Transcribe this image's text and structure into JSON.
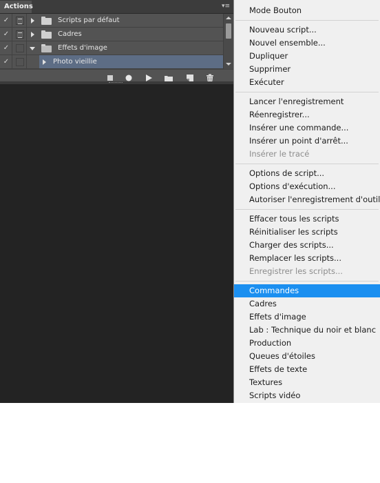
{
  "panel": {
    "tab_label": "Actions",
    "menu_glyph": "▾≡",
    "rows": [
      {
        "label": "Scripts par défaut",
        "checked": true,
        "dialog": true,
        "expanded": false,
        "type": "folder"
      },
      {
        "label": "Cadres",
        "checked": true,
        "dialog": true,
        "expanded": false,
        "type": "folder"
      },
      {
        "label": "Effets d'image",
        "checked": true,
        "dialog": false,
        "expanded": true,
        "type": "folder"
      },
      {
        "label": "Photo vieillie",
        "checked": true,
        "dialog": false,
        "expanded": false,
        "type": "action",
        "selected": true
      }
    ],
    "check_glyph": "✓",
    "toolbar_icons": [
      "stop-icon",
      "record-icon",
      "play-icon",
      "folder-new-icon",
      "new-action-icon",
      "trash-icon"
    ]
  },
  "menu": {
    "items": [
      {
        "label": "Mode Bouton",
        "state": "normal"
      },
      {
        "separator": true
      },
      {
        "label": "Nouveau script...",
        "state": "normal"
      },
      {
        "label": "Nouvel ensemble...",
        "state": "normal"
      },
      {
        "label": "Dupliquer",
        "state": "normal"
      },
      {
        "label": "Supprimer",
        "state": "normal"
      },
      {
        "label": "Exécuter",
        "state": "normal"
      },
      {
        "separator": true
      },
      {
        "label": "Lancer l'enregistrement",
        "state": "normal"
      },
      {
        "label": "Réenregistrer...",
        "state": "normal"
      },
      {
        "label": "Insérer une commande...",
        "state": "normal"
      },
      {
        "label": "Insérer un point d'arrêt...",
        "state": "normal"
      },
      {
        "label": "Insérer le tracé",
        "state": "disabled"
      },
      {
        "separator": true
      },
      {
        "label": "Options de script...",
        "state": "normal"
      },
      {
        "label": "Options d'exécution...",
        "state": "normal"
      },
      {
        "label": "Autoriser l'enregistrement d'outil",
        "state": "normal"
      },
      {
        "separator": true
      },
      {
        "label": "Effacer tous les scripts",
        "state": "normal"
      },
      {
        "label": "Réinitialiser les scripts",
        "state": "normal"
      },
      {
        "label": "Charger des scripts...",
        "state": "normal"
      },
      {
        "label": "Remplacer les scripts...",
        "state": "normal"
      },
      {
        "label": "Enregistrer les scripts...",
        "state": "disabled"
      },
      {
        "separator": true
      },
      {
        "label": "Commandes",
        "state": "active"
      },
      {
        "label": "Cadres",
        "state": "normal"
      },
      {
        "label": "Effets d'image",
        "state": "normal"
      },
      {
        "label": "Lab : Technique du noir et blanc",
        "state": "normal"
      },
      {
        "label": "Production",
        "state": "normal"
      },
      {
        "label": "Queues d'étoiles",
        "state": "normal"
      },
      {
        "label": "Effets de texte",
        "state": "normal"
      },
      {
        "label": "Textures",
        "state": "normal"
      },
      {
        "label": "Scripts vidéo",
        "state": "normal"
      }
    ]
  },
  "colors": {
    "highlight": "#1b8ff0",
    "selected_row": "#5d6d85",
    "workspace": "#232323"
  }
}
